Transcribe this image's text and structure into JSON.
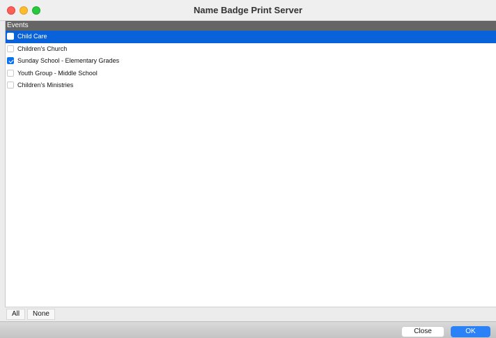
{
  "window": {
    "title": "Name Badge Print Server"
  },
  "events": {
    "header": "Events",
    "items": [
      {
        "label": "Child Care",
        "checked": false,
        "selected": true
      },
      {
        "label": "Children's Church",
        "checked": false,
        "selected": false
      },
      {
        "label": "Sunday School - Elementary Grades",
        "checked": true,
        "selected": false
      },
      {
        "label": "Youth Group - Middle School",
        "checked": false,
        "selected": false
      },
      {
        "label": "Children's Ministries",
        "checked": false,
        "selected": false
      }
    ]
  },
  "selection_buttons": {
    "all": "All",
    "none": "None"
  },
  "footer": {
    "close": "Close",
    "ok": "OK"
  },
  "colors": {
    "selection": "#0962d9",
    "header_bg": "#656565",
    "ok_button": "#2b82f6"
  }
}
